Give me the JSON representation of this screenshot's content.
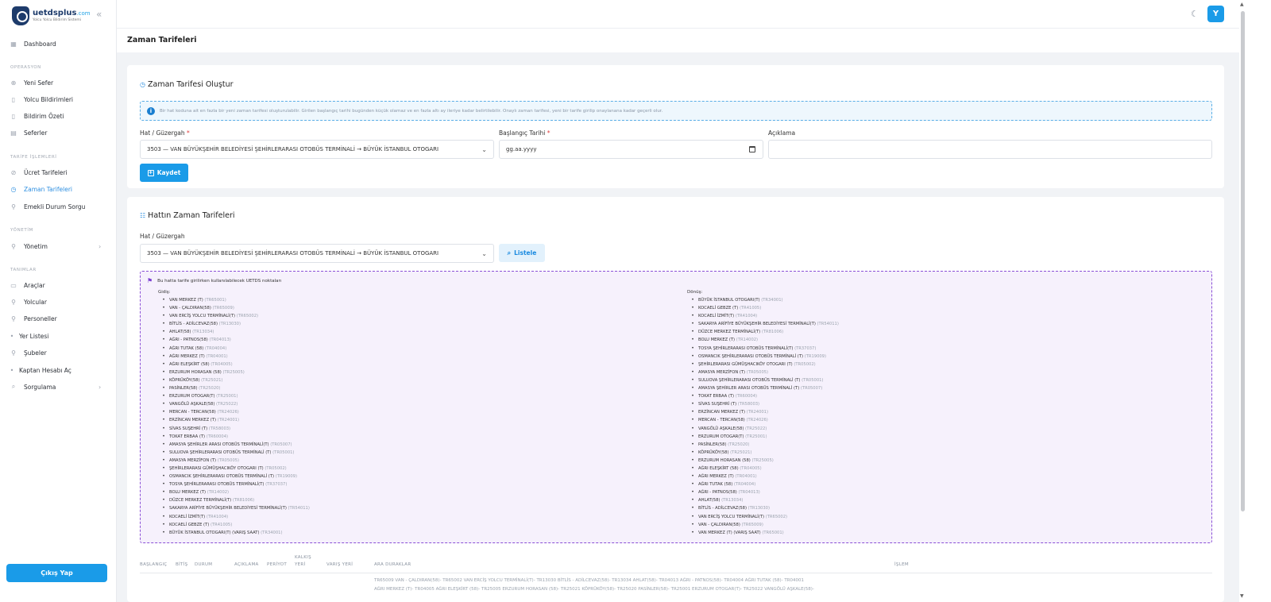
{
  "app": {
    "logo_name": "uetdsplus",
    "logo_domain": ".com",
    "logo_tagline": "Yolcu Yolcu Bildirim Sistemi"
  },
  "sidebar": {
    "dashboard": "Dashboard",
    "sections": {
      "operasyon": "OPERASYON",
      "tarife": "TARİFE İŞLEMLERİ",
      "yonetim": "YÖNETİM",
      "tanimlar": "TANIMLAR"
    },
    "items": {
      "yeni_sefer": "Yeni Sefer",
      "yolcu_bildirimleri": "Yolcu Bildirimleri",
      "bildirim_ozeti": "Bildirim Özeti",
      "seferler": "Seferler",
      "ucret_tarifeleri": "Ücret Tarifeleri",
      "zaman_tarifeleri": "Zaman Tarifeleri",
      "emekli_durum_sorgu": "Emekli Durum Sorgu",
      "yonetim": "Yönetim",
      "araclar": "Araçlar",
      "yolcular": "Yolcular",
      "personeller": "Personeller",
      "yer_listesi": "Yer Listesi",
      "subeler": "Şubeler",
      "kaptan_hesabi_ac": "Kaptan Hesabı Aç",
      "sorgulama": "Sorgulama"
    },
    "logout": "Çıkış Yap"
  },
  "topbar": {
    "avatar_initial": "Y"
  },
  "page": {
    "title": "Zaman Tarifeleri"
  },
  "create_card": {
    "title": "Zaman Tarifesi Oluştur",
    "info": "Bir hat koduna ait en fazla bir yeni zaman tarifesi oluşturulabilir. Girilen başlangıç tarihi bugünden küçük olamaz ve en fazla altı ay ileriye kadar belirtilebilir. Onaylı zaman tarifesi, yeni bir tarife girilip onaylanana kadar geçerli olur.",
    "route_label": "Hat / Güzergah",
    "route_value": "3503 — VAN BÜYÜKŞEHİR BELEDİYESİ ŞEHİRLERARASI OTOBÜS TERMİNALİ → BÜYÜK İSTANBUL OTOGARI",
    "start_date_label": "Başlangıç Tarihi",
    "start_date_placeholder": "gg.aa.yyyy",
    "description_label": "Açıklama",
    "description_value": "",
    "required_mark": "*",
    "save_button": "Kaydet"
  },
  "list_card": {
    "title": "Hattın Zaman Tarifeleri",
    "route_label": "Hat / Güzergah",
    "route_value": "3503 — VAN BÜYÜKŞEHİR BELEDİYESİ ŞEHİRLERARASI OTOBÜS TERMİNALİ → BÜYÜK İSTANBUL OTOGARI",
    "list_button": "Listele",
    "stops_heading": "Bu hatta tarife girilirken kullanılabilecek UETDS noktaları",
    "outbound_title": "Gidiş:",
    "return_title": "Dönüş:",
    "outbound": [
      {
        "name": "VAN MERKEZ (T)",
        "code": "(TR65001)"
      },
      {
        "name": "VAN - ÇALDIRAN(58)",
        "code": "(TR65009)"
      },
      {
        "name": "VAN ERCİŞ YOLCU TERMİNALİ(T)",
        "code": "(TR65002)"
      },
      {
        "name": "BİTLİS - ADİLCEVAZ(58)",
        "code": "(TR13030)"
      },
      {
        "name": "AHLAT(58)",
        "code": "(TR13034)"
      },
      {
        "name": "AĞRI - PATNOS(58)",
        "code": "(TR04013)"
      },
      {
        "name": "AĞRI TUTAK (58)",
        "code": "(TR04004)"
      },
      {
        "name": "AĞRI MERKEZ (T)",
        "code": "(TR04001)"
      },
      {
        "name": "AĞRI ELEŞKİRT (58)",
        "code": "(TR04005)"
      },
      {
        "name": "ERZURUM HORASAN (58)",
        "code": "(TR25005)"
      },
      {
        "name": "KÖPRÜKÖY(58)",
        "code": "(TR25021)"
      },
      {
        "name": "PASİNLER(58)",
        "code": "(TR25020)"
      },
      {
        "name": "ERZURUM OTOGAR(T)",
        "code": "(TR25001)"
      },
      {
        "name": "VANGÖLÜ AŞKALE(58)",
        "code": "(TR25022)"
      },
      {
        "name": "MERCAN - TERCAN(58)",
        "code": "(TR24026)"
      },
      {
        "name": "ERZİNCAN MERKEZ (T)",
        "code": "(TR24001)"
      },
      {
        "name": "SİVAS SUŞEHRİ (T)",
        "code": "(TR58003)"
      },
      {
        "name": "TOKAT ERBAA (T)",
        "code": "(TR60004)"
      },
      {
        "name": "AMASYA ŞEHİRLER ARASI OTOBÜS TERMİNALİ(T)",
        "code": "(TR05007)"
      },
      {
        "name": "SULUOVA ŞEHİRLERARASI OTOBÜS TERMİNALİ (T)",
        "code": "(TR05001)"
      },
      {
        "name": "AMASYA MERZİFON (T)",
        "code": "(TR05005)"
      },
      {
        "name": "ŞEHİRLERARASI GÜMÜŞHACIKÖY OTOGARI (T)",
        "code": "(TR05002)"
      },
      {
        "name": "OSMANCIK ŞEHİRLERARASI OTOBÜS TERMİNALİ (T)",
        "code": "(TR19009)"
      },
      {
        "name": "TOSYA ŞEHİRLERARASI OTOBÜS TERMİNALİ(T)",
        "code": "(TR37037)"
      },
      {
        "name": "BOLU MERKEZ (T)",
        "code": "(TR14002)"
      },
      {
        "name": "DÜZCE MERKEZ TERMİNALİ(T)",
        "code": "(TR81006)"
      },
      {
        "name": "SAKARYA ARİFİYE BÜYÜKŞEHİR BELEDİYESİ TERMİNALİ(T)",
        "code": "(TR54011)"
      },
      {
        "name": "KOCAELİ İZMİT(T)",
        "code": "(TR41004)"
      },
      {
        "name": "KOCAELİ GEBZE (T)",
        "code": "(TR41005)"
      },
      {
        "name": "BÜYÜK İSTANBUL OTOGARI(T) (VARIŞ SAAT)",
        "code": "(TR34001)"
      }
    ],
    "return": [
      {
        "name": "BÜYÜK İSTANBUL OTOGARI(T)",
        "code": "(TR34001)"
      },
      {
        "name": "KOCAELİ GEBZE (T)",
        "code": "(TR41005)"
      },
      {
        "name": "KOCAELİ İZMİT(T)",
        "code": "(TR41004)"
      },
      {
        "name": "SAKARYA ARİFİYE BÜYÜKŞEHİR BELEDİYESİ TERMİNALİ(T)",
        "code": "(TR54011)"
      },
      {
        "name": "DÜZCE MERKEZ TERMİNALİ(T)",
        "code": "(TR81006)"
      },
      {
        "name": "BOLU MERKEZ (T)",
        "code": "(TR14002)"
      },
      {
        "name": "TOSYA ŞEHİRLERARASI OTOBÜS TERMİNALİ(T)",
        "code": "(TR37037)"
      },
      {
        "name": "OSMANCIK ŞEHİRLERARASI OTOBÜS TERMİNALİ (T)",
        "code": "(TR19009)"
      },
      {
        "name": "ŞEHİRLERARASI GÜMÜŞHACIKÖY OTOGARI (T)",
        "code": "(TR05002)"
      },
      {
        "name": "AMASYA MERZİFON (T)",
        "code": "(TR05005)"
      },
      {
        "name": "SULUOVA ŞEHİRLERARASI OTOBÜS TERMİNALİ (T)",
        "code": "(TR05001)"
      },
      {
        "name": "AMASYA ŞEHİRLER ARASI OTOBÜS TERMİNALİ (T)",
        "code": "(TR05007)"
      },
      {
        "name": "TOKAT ERBAA (T)",
        "code": "(TR60004)"
      },
      {
        "name": "SİVAS SUŞEHRİ (T)",
        "code": "(TR58003)"
      },
      {
        "name": "ERZİNCAN MERKEZ (T)",
        "code": "(TR24001)"
      },
      {
        "name": "MERCAN - TERCAN(58)",
        "code": "(TR24026)"
      },
      {
        "name": "VANGÖLÜ AŞKALE(58)",
        "code": "(TR25022)"
      },
      {
        "name": "ERZURUM OTOGAR(T)",
        "code": "(TR25001)"
      },
      {
        "name": "PASİNLER(58)",
        "code": "(TR25020)"
      },
      {
        "name": "KÖPRÜKÖY(58)",
        "code": "(TR25021)"
      },
      {
        "name": "ERZURUM HORASAN (58)",
        "code": "(TR25005)"
      },
      {
        "name": "AĞRI ELEŞKİRT (58)",
        "code": "(TR04005)"
      },
      {
        "name": "AĞRI MERKEZ (T)",
        "code": "(TR04001)"
      },
      {
        "name": "AĞRI TUTAK (58)",
        "code": "(TR04004)"
      },
      {
        "name": "AĞRI - PATNOS(58)",
        "code": "(TR04013)"
      },
      {
        "name": "AHLAT(58)",
        "code": "(TR13034)"
      },
      {
        "name": "BİTLİS - ADİLCEVAZ(58)",
        "code": "(TR13030)"
      },
      {
        "name": "VAN ERCİŞ YOLCU TERMİNALİ(T)",
        "code": "(TR65002)"
      },
      {
        "name": "VAN - ÇALDIRAN(58)",
        "code": "(TR65009)"
      },
      {
        "name": "VAN MERKEZ (T) (VARIŞ SAAT)",
        "code": "(TR65001)"
      }
    ],
    "table": {
      "headers": {
        "baslangic": "BAŞLANGIÇ",
        "bitis": "BİTİŞ",
        "durum": "DURUM",
        "aciklama": "AÇIKLAMA",
        "periyot": "PERİYOT",
        "kalkis_1": "KALKIŞ",
        "kalkis_2": "YERİ",
        "varis": "VARIŞ YERİ",
        "ara_duraklar": "ARA DURAKLAR",
        "islem": "İŞLEM"
      },
      "row_stops_line1": "TR65009 VAN - ÇALDIRAN(58)- TR65002 VAN ERCİŞ YOLCU TERMİNALİ(T)- TR13030 BİTLİS - ADİLCEVAZ(58)- TR13034 AHLAT(58)- TR04013 AĞRI - PATNOS(58)- TR04004 AĞRI TUTAK (58)- TR04001",
      "row_stops_line2": "AĞRI MERKEZ (T)- TR04005 AĞRI ELEŞKİRT (58)- TR25005 ERZURUM HORASAN (58)- TR25021 KÖPRÜKÖY(58)- TR25020 PASİNLER(58)- TR25001 ERZURUM OTOGAR(T)- TR25022 VANGÖLÜ AŞKALE(58)-"
    }
  }
}
